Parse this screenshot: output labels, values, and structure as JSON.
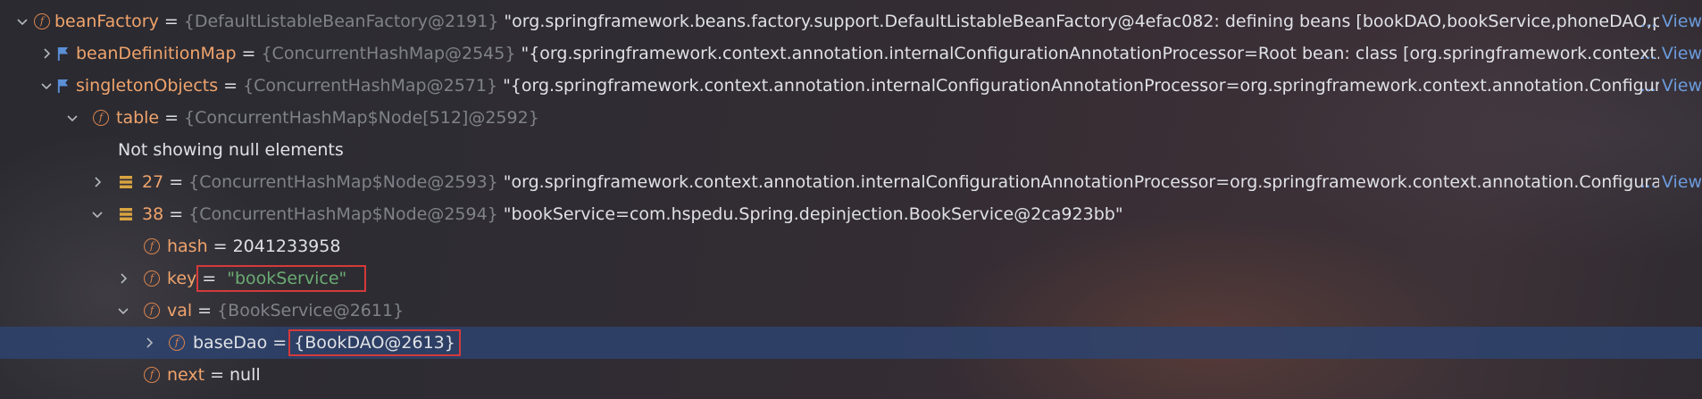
{
  "colors": {
    "field_name": "#f0a46c",
    "type_ref": "#7f8288",
    "string": "#6aab73",
    "link": "#6b9bdc",
    "selection": "#2e436e",
    "highlight_box": "#d43a3a"
  },
  "rows": {
    "beanFactory": {
      "name": "beanFactory",
      "type": "{DefaultListableBeanFactory@2191}",
      "value": "\"org.springframework.beans.factory.support.DefaultListableBeanFactory@4efac082: defining beans [bookDAO,bookService,phoneDAO,phone",
      "view": "... View"
    },
    "beanDefinitionMap": {
      "name": "beanDefinitionMap",
      "type": "{ConcurrentHashMap@2545}",
      "value": "\"{org.springframework.context.annotation.internalConfigurationAnnotationProcessor=Root bean: class [org.springframework.context.annot",
      "view": "... View"
    },
    "singletonObjects": {
      "name": "singletonObjects",
      "type": "{ConcurrentHashMap@2571}",
      "value": "\"{org.springframework.context.annotation.internalConfigurationAnnotationProcessor=org.springframework.context.annotation.ConfigurationC",
      "view": "... View"
    },
    "table": {
      "name": "table",
      "type": "{ConcurrentHashMap$Node[512]@2592}"
    },
    "not_showing": {
      "text": "Not showing null elements"
    },
    "item27": {
      "name": "27",
      "type": "{ConcurrentHashMap$Node@2593}",
      "value": "\"org.springframework.context.annotation.internalConfigurationAnnotationProcessor=org.springframework.context.annotation.ConfigurationCla",
      "view": "... View"
    },
    "item38": {
      "name": "38",
      "type": "{ConcurrentHashMap$Node@2594}",
      "value": "\"bookService=com.hspedu.Spring.depinjection.BookService@2ca923bb\""
    },
    "hash": {
      "name": "hash",
      "value": "2041233958"
    },
    "key": {
      "name": "key",
      "value": "\"bookService\""
    },
    "val": {
      "name": "val",
      "type": "{BookService@2611}"
    },
    "baseDao": {
      "name": "baseDao",
      "value": "{BookDAO@2613}"
    },
    "next": {
      "name": "next",
      "value": "null"
    }
  },
  "equals": "="
}
